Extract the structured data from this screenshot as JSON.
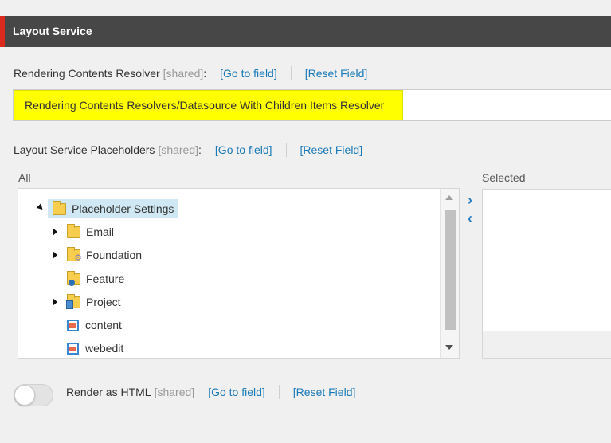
{
  "section": {
    "title": "Layout Service"
  },
  "resolver_field": {
    "label": "Rendering Contents Resolver",
    "shared": "[shared]",
    "colon": ":",
    "go_to_field": "[Go to field]",
    "reset_field": "[Reset Field]",
    "value": "Rendering Contents Resolvers/Datasource With Children Items Resolver"
  },
  "placeholders_field": {
    "label": "Layout Service Placeholders",
    "shared": "[shared]",
    "colon": ":",
    "go_to_field": "[Go to field]",
    "reset_field": "[Reset Field]",
    "all_label": "All",
    "selected_label": "Selected",
    "tree": [
      {
        "label": "Placeholder Settings",
        "icon": "folder-icon",
        "expanded": true,
        "selected": true
      },
      {
        "label": "Email",
        "icon": "folder-icon",
        "expandable": true
      },
      {
        "label": "Foundation",
        "icon": "folder-gear-icon",
        "expandable": true
      },
      {
        "label": "Feature",
        "icon": "folder-people-icon",
        "expandable": false
      },
      {
        "label": "Project",
        "icon": "folder-blue-icon",
        "expandable": true
      },
      {
        "label": "content",
        "icon": "placeholder-icon",
        "expandable": false
      },
      {
        "label": "webedit",
        "icon": "placeholder-icon",
        "expandable": false
      }
    ],
    "move_right": "›",
    "move_left": "‹"
  },
  "render_html_field": {
    "label": "Render as HTML",
    "shared": "[shared]",
    "go_to_field": "[Go to field]",
    "reset_field": "[Reset Field]",
    "enabled": false
  },
  "colors": {
    "accent": "#dc291e",
    "header": "#474747",
    "link": "#1a7ab8",
    "highlight": "#ffff00",
    "tree_selected": "#cfe8f3"
  }
}
